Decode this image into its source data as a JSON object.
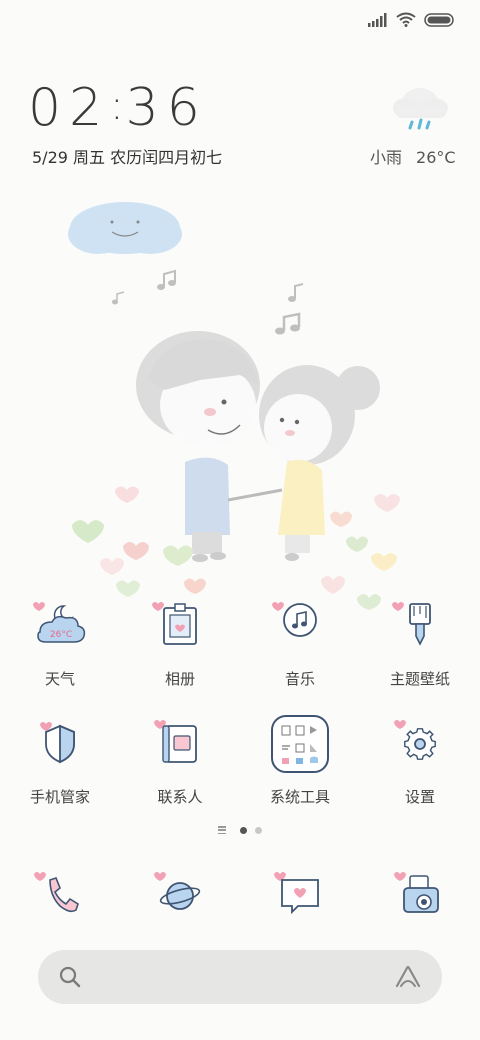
{
  "status_bar": {
    "icons": [
      "signal-icon",
      "wifi-icon",
      "battery-icon"
    ]
  },
  "lock": {
    "hour": "02",
    "separator": ":",
    "minute": "36",
    "date": "5/29 周五 农历闰四月初七"
  },
  "weather": {
    "condition": "小雨",
    "temperature": "26°C",
    "icon": "rain-cloud-icon",
    "widget_temp": "26°C"
  },
  "apps": {
    "row1": [
      {
        "label": "天气",
        "icon": "weather-icon"
      },
      {
        "label": "相册",
        "icon": "gallery-icon"
      },
      {
        "label": "音乐",
        "icon": "music-icon"
      },
      {
        "label": "主题壁纸",
        "icon": "theme-brush-icon"
      }
    ],
    "row2": [
      {
        "label": "手机管家",
        "icon": "shield-icon"
      },
      {
        "label": "联系人",
        "icon": "contacts-book-icon"
      },
      {
        "label": "系统工具",
        "icon": "tools-folder-icon"
      },
      {
        "label": "设置",
        "icon": "gear-icon"
      }
    ],
    "dock": [
      {
        "icon": "phone-icon"
      },
      {
        "icon": "browser-planet-icon"
      },
      {
        "icon": "message-icon"
      },
      {
        "icon": "camera-icon"
      }
    ]
  },
  "pager": {
    "pages": 2,
    "active": 1
  },
  "search": {
    "icons": [
      "search-icon",
      "voice-assistant-icon"
    ]
  },
  "colors": {
    "background": "#fbfbf9",
    "icon_stroke": "#3f5573",
    "icon_fill": "#b9d4ef",
    "heart_pink": "#f2a0b4",
    "search_bg": "#e6e6e4"
  }
}
